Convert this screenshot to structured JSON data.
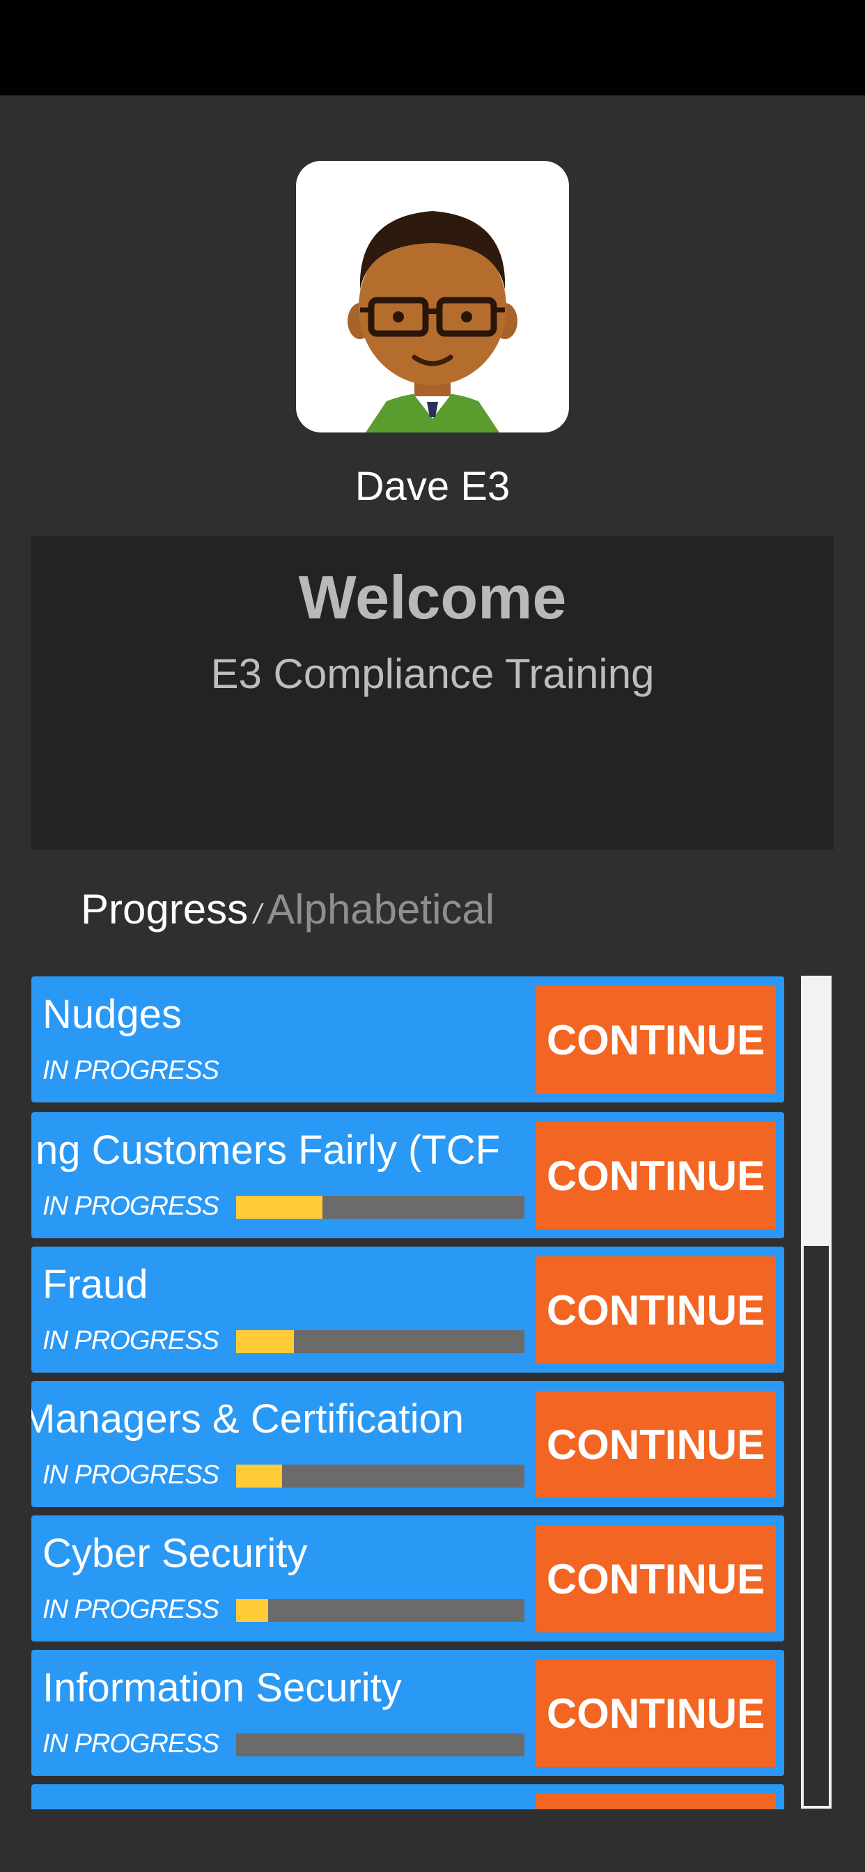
{
  "user": {
    "name": "Dave E3"
  },
  "welcome": {
    "title": "Welcome",
    "subtitle": "E3 Compliance Training"
  },
  "sort": {
    "active_label": "Progress",
    "separator": "/",
    "inactive_label": "Alphabetical"
  },
  "courses": [
    {
      "title": "Nudges",
      "status": "IN PROGRESS",
      "progress": null,
      "button": "CONTINUE"
    },
    {
      "title": "ng Customers Fairly (TCF",
      "status": "IN PROGRESS",
      "progress": 0.3,
      "button": "CONTINUE"
    },
    {
      "title": "Fraud",
      "status": "IN PROGRESS",
      "progress": 0.2,
      "button": "CONTINUE"
    },
    {
      "title": "Managers & Certification",
      "status": "IN PROGRESS",
      "progress": 0.16,
      "button": "CONTINUE"
    },
    {
      "title": "Cyber Security",
      "status": "IN PROGRESS",
      "progress": 0.11,
      "button": "CONTINUE"
    },
    {
      "title": "Information Security",
      "status": "IN PROGRESS",
      "progress": 0.0,
      "button": "CONTINUE"
    }
  ],
  "colors": {
    "card": "#2a98f5",
    "button": "#f26522",
    "progress_fill": "#ffcb37",
    "progress_track": "#6b6b6b"
  },
  "icons": {
    "avatar": "avatar-cartoon-man-glasses"
  }
}
